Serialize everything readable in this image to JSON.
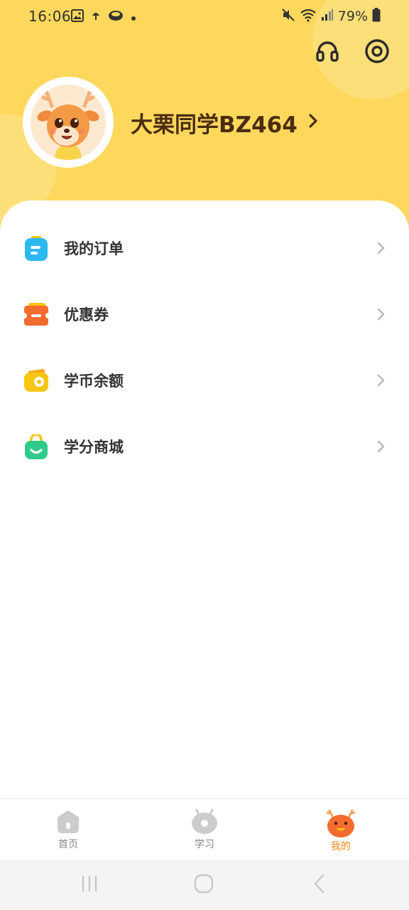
{
  "status_bar": {
    "time": "16:06",
    "battery": "79%",
    "left_icons": [
      "gallery-icon",
      "weather-icon",
      "app-icon",
      "dot-icon"
    ],
    "right_icons": [
      "mute-icon",
      "wifi-icon",
      "signal-icon",
      "battery-icon"
    ]
  },
  "header": {
    "background_color": "#fdd85c",
    "actions": [
      "headset-icon",
      "settings-icon"
    ]
  },
  "profile": {
    "name": "大栗同学BZ464",
    "avatar": "deer-mascot-avatar"
  },
  "menu": {
    "items": [
      {
        "label": "我的订单",
        "icon": "order-icon",
        "color": "#2cb9f0"
      },
      {
        "label": "优惠券",
        "icon": "coupon-icon",
        "color": "#f26b2f"
      },
      {
        "label": "学币余额",
        "icon": "wallet-icon",
        "color": "#f7c512"
      },
      {
        "label": "学分商城",
        "icon": "shop-bag-icon",
        "color": "#2fcb8c"
      }
    ]
  },
  "tabbar": {
    "tabs": [
      {
        "label": "首页",
        "icon": "home-icon",
        "active": false
      },
      {
        "label": "学习",
        "icon": "study-icon",
        "active": false
      },
      {
        "label": "我的",
        "icon": "mine-icon",
        "active": true
      }
    ],
    "active_color": "#f08a1c",
    "inactive_color": "#888888"
  },
  "system_nav": {
    "buttons": [
      "recents-button",
      "home-button",
      "back-button"
    ]
  }
}
